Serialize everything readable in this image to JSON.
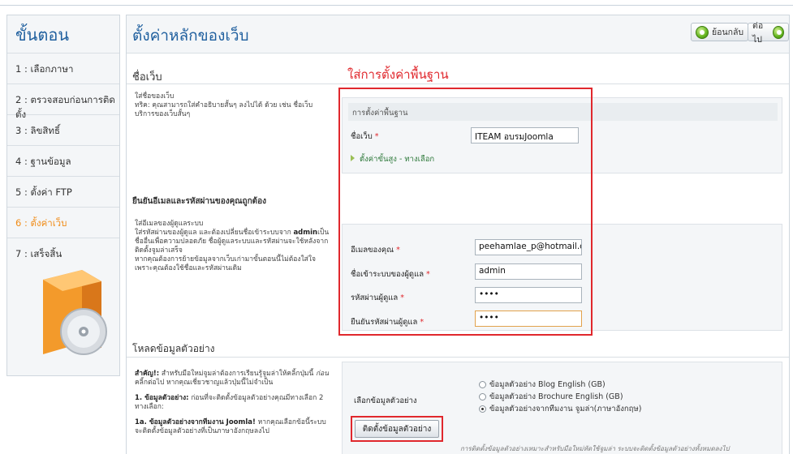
{
  "sidebar": {
    "title": "ขั้นตอน",
    "steps": [
      {
        "label": "1 : เลือกภาษา"
      },
      {
        "label": "2 : ตรวจสอบก่อนการติดตั้ง"
      },
      {
        "label": "3 : ลิขสิทธิ์"
      },
      {
        "label": "4 : ฐานข้อมูล"
      },
      {
        "label": "5 : ตั้งค่า FTP"
      },
      {
        "label": "6 : ตั้งค่าเว็บ"
      },
      {
        "label": "7 : เสร็จสิ้น"
      }
    ],
    "active_step": 6
  },
  "header": {
    "title": "ตั้งค่าหลักของเว็บ",
    "back_label": "ย้อนกลับ",
    "next_label": "ต่อไป"
  },
  "annotation": "ใส่การตั้งค่าพื้นฐาน",
  "site_name_section": {
    "heading": "ชื่อเว็บ",
    "help_title": "ใส่ชื่อของเว็บ",
    "help_text": "ทริค: คุณสามารถใส่คำอธิบายสั้นๆ ลงไปได้ ด้วย เช่น ชื่อเว็บ บริการของเว็บสั้นๆ",
    "band_label": "การตั้งค่าพื้นฐาน",
    "site_name_label": "ชื่อเว็บ",
    "site_name_value": "ITEAM อบรมJoomla",
    "advanced_label": "ตั้งค่าขั้นสูง - ทางเลือก"
  },
  "admin_section": {
    "heading": "ยืนยันอีเมลและรหัสผ่านของคุณถูกต้อง",
    "help_title": "ใส่อีเมลของผู้ดูแลระบบ",
    "help_text_1": "ใส่รหัสผ่านของผู้ดูแล และต้องเปลี่ยนชื่อเข้าระบบจาก",
    "help_bold": "admin",
    "help_text_2": "เป็นชื่ออื่นเพื่อความปลอดภัย ชื่อผู้ดูแลระบบและรหัสผ่านจะใช้หลังจากติดตั้งจูมล่าเสร็จ",
    "help_text_3": "หากคุณต้องการย้ายข้อมูลจากเว็บเก่ามาขั้นตอนนี้ไม่ต้องใส่ใจเพราะคุณต้องใช้ชื่อและรหัสผ่านเดิม",
    "email_label": "อีเมลของคุณ",
    "email_value": "peehamlae_p@hotmail.com",
    "username_label": "ชื่อเข้าระบบของผู้ดูแล",
    "username_value": "admin",
    "password_label": "รหัสผ่านผู้ดูแล",
    "password_value": "••••",
    "confirm_label": "ยืนยันรหัสผ่านผู้ดูแล",
    "confirm_value": "••••"
  },
  "sample_section": {
    "heading": "โหลดข้อมูลตัวอย่าง",
    "important_bold": "สำคัญ!:",
    "important_text": "สำหรับมือใหม่จูมล่าต้องการเรียนรู้จูมล่าให้คลิ้กปุ่มนี้",
    "important_italic": "ก่อน",
    "important_text_2": "คลิ้กต่อไป หากคุณเชี่ยวชาญแล้วปุ่มนี้ไม่จำเป็น",
    "item1_bold": "1. ข้อมูลตัวอย่าง:",
    "item1_text": "ก่อนที่จะติดตั้งข้อมูลตัวอย่างคุณมีทางเลือก 2 ทางเลือก:",
    "item1a_bold": "1a. ข้อมูลตัวอย่างจากทีมงาน Joomla!",
    "item1a_text": "หากคุณเลือกข้อนี้ระบบจะติดตั้งข้อมูลตัวอย่างที่เป็นภาษาอังกฤษลงไป",
    "select_label": "เลือกข้อมูลตัวอย่าง",
    "options": [
      {
        "label": "ข้อมูลตัวอย่าง Blog English (GB)",
        "selected": false
      },
      {
        "label": "ข้อมูลตัวอย่าง Brochure English (GB)",
        "selected": false
      },
      {
        "label": "ข้อมูลตัวอย่างจากทีมงาน จูมล่า(ภาษาอังกฤษ)",
        "selected": true
      }
    ],
    "install_label": "ติดตั้งข้อมูลตัวอย่าง",
    "install_note": "การติดตั้งข้อมูลตัวอย่างเหมาะสำหรับมือใหม่หัดใช้จูมล่า ระบบจะติดตั้งข้อมูลตัวอย่างทั้งหมดลงไป"
  },
  "colors": {
    "accent": "#1f5f9e",
    "active": "#f08c18",
    "highlight": "#e0282d"
  }
}
